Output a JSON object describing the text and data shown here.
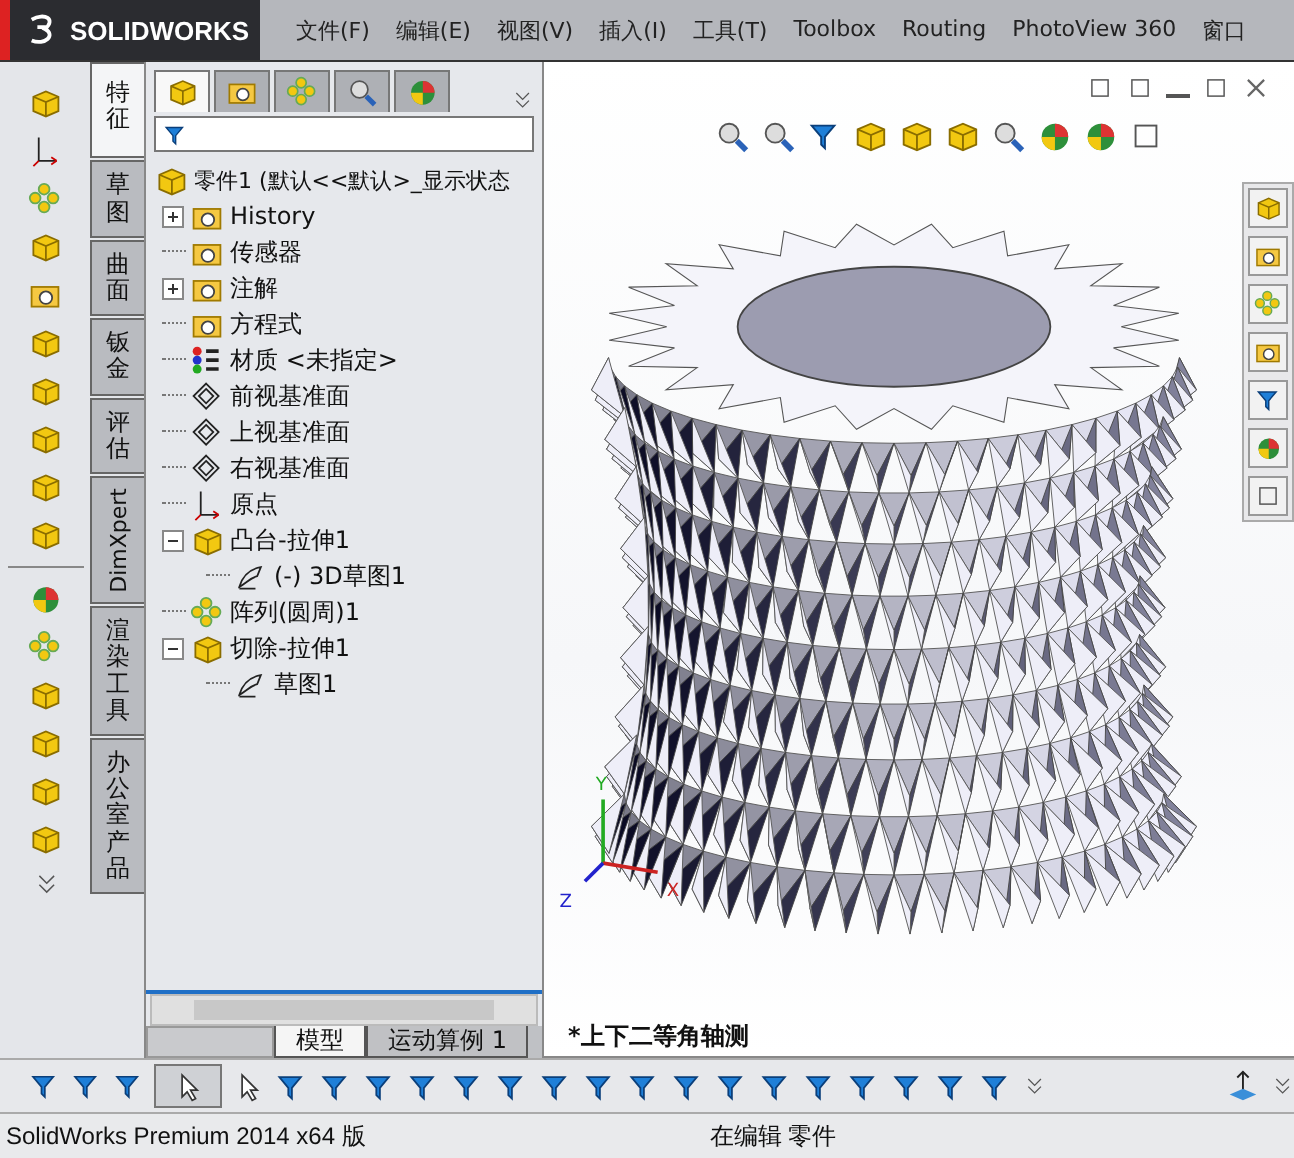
{
  "title_bar": {
    "logo": "SOLIDWORKS",
    "menu": [
      "文件(F)",
      "编辑(E)",
      "视图(V)",
      "插入(I)",
      "工具(T)",
      "Toolbox",
      "Routing",
      "PhotoView 360",
      "窗口"
    ]
  },
  "side_tabs": [
    {
      "label": "特征",
      "kind": "stacked",
      "selected": true
    },
    {
      "label": "草图",
      "kind": "stacked",
      "selected": false
    },
    {
      "label": "曲面",
      "kind": "stacked",
      "selected": false
    },
    {
      "label": "钣金",
      "kind": "stacked",
      "selected": false
    },
    {
      "label": "评估",
      "kind": "stacked",
      "selected": false
    },
    {
      "label": "DimXpert",
      "kind": "rotated",
      "selected": false
    },
    {
      "label": "渲染工具",
      "kind": "stacked",
      "selected": false
    },
    {
      "label": "办公室产品",
      "kind": "stacked",
      "selected": false
    }
  ],
  "manager_tabs": [
    {
      "selected": true
    },
    {
      "selected": false
    },
    {
      "selected": false
    },
    {
      "selected": false
    },
    {
      "selected": false
    }
  ],
  "tree": {
    "root": {
      "label": "零件1 (默认<<默认>_显示状态",
      "kind": "part"
    },
    "items": [
      {
        "label": "History",
        "kind": "history",
        "expanded": false
      },
      {
        "label": "传感器",
        "kind": "sensor"
      },
      {
        "label": "注解",
        "kind": "annotation",
        "expanded": false
      },
      {
        "label": "方程式",
        "kind": "equation"
      },
      {
        "label": "材质 <未指定>",
        "kind": "material"
      },
      {
        "label": "前视基准面",
        "kind": "plane"
      },
      {
        "label": "上视基准面",
        "kind": "plane"
      },
      {
        "label": "右视基准面",
        "kind": "plane"
      },
      {
        "label": "原点",
        "kind": "origin"
      },
      {
        "label": "凸台-拉伸1",
        "kind": "feature",
        "expanded": true,
        "children": [
          {
            "label": "(-) 3D草图1",
            "kind": "sketch"
          }
        ]
      },
      {
        "label": "阵列(圆周)1",
        "kind": "pattern"
      },
      {
        "label": "切除-拉伸1",
        "kind": "cut",
        "expanded": true,
        "children": [
          {
            "label": "草图1",
            "kind": "sketch"
          }
        ]
      }
    ]
  },
  "bottom_tabs": [
    {
      "label": "模型",
      "selected": true
    },
    {
      "label": "运动算例 1",
      "selected": false
    }
  ],
  "viewport": {
    "view_name": "*上下二等角轴测",
    "axes": {
      "x": "X",
      "y": "Y",
      "z": "Z"
    }
  },
  "status_bar": {
    "product": "SolidWorks Premium 2014 x64 版",
    "mode": "在编辑 零件"
  }
}
